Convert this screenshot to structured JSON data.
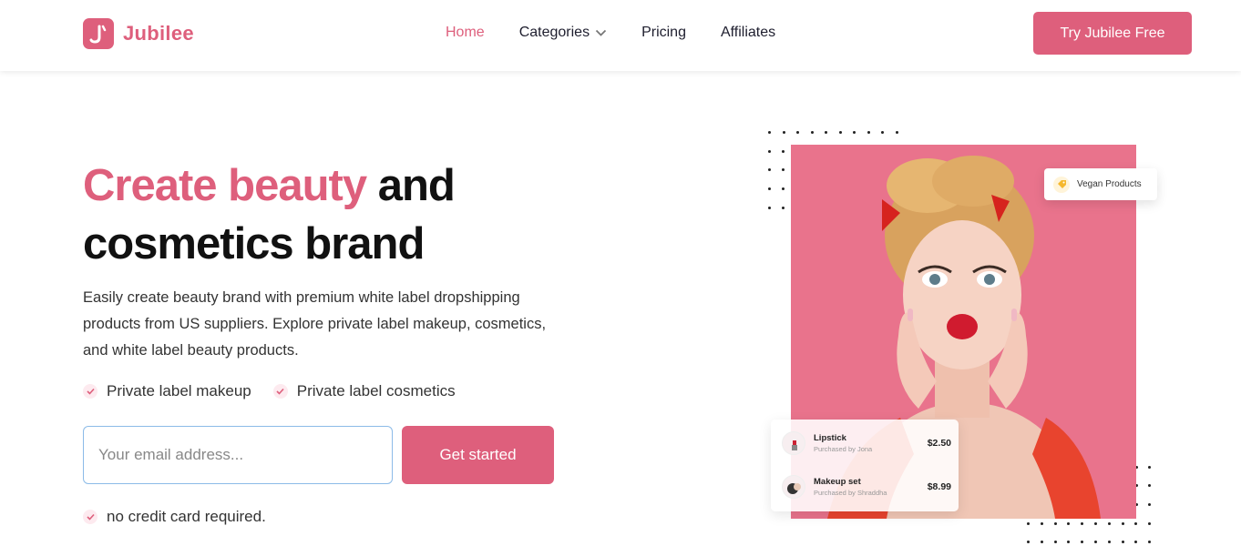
{
  "brand": {
    "name": "Jubilee",
    "accent": "#de5f7c"
  },
  "nav": {
    "items": [
      {
        "label": "Home",
        "active": true
      },
      {
        "label": "Categories",
        "has_dropdown": true
      },
      {
        "label": "Pricing"
      },
      {
        "label": "Affiliates"
      }
    ],
    "cta_label": "Try Jubilee Free"
  },
  "hero": {
    "title_highlight": "Create beauty",
    "title_rest_1": " and",
    "title_line_2": "cosmetics brand",
    "description": "Easily create beauty brand with premium white label dropshipping products from US suppliers. Explore private label makeup, cosmetics, and white label beauty products.",
    "features": [
      "Private label makeup",
      "Private label cosmetics"
    ],
    "email_placeholder": "Your email address...",
    "submit_label": "Get started",
    "note": "no credit card required."
  },
  "visual": {
    "badge_label": "Vegan Products",
    "products": [
      {
        "name": "Lipstick",
        "sub": "Purchased by Jona",
        "price": "$2.50"
      },
      {
        "name": "Makeup set",
        "sub": "Purchased by Shraddha",
        "price": "$8.99"
      }
    ]
  }
}
